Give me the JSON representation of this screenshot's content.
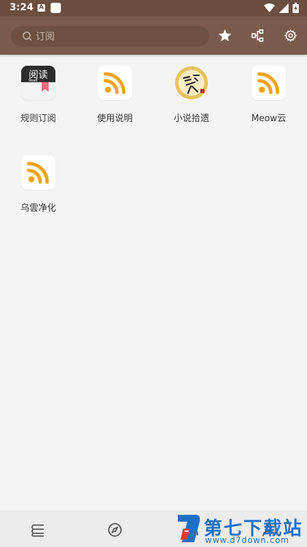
{
  "status_bar": {
    "time": "3:24",
    "a_badge": "A"
  },
  "toolbar": {
    "search_placeholder": "订阅"
  },
  "tiles": [
    {
      "label": "规则订阅",
      "icon": "read-app-icon",
      "icon_text": "阅读",
      "icon_subtext": "Read"
    },
    {
      "label": "使用说明",
      "icon": "rss-icon"
    },
    {
      "label": "小说拾遗",
      "icon": "book-seal-icon"
    },
    {
      "label": "Meow云",
      "icon": "rss-icon"
    },
    {
      "label": "乌雲净化",
      "icon": "rss-icon"
    }
  ],
  "watermark": {
    "title": "第七下载站",
    "url": "www.d7down.com"
  },
  "colors": {
    "toolbar": "#7a5b4b",
    "status": "#6b4e3f",
    "rss": "#f2a21b",
    "background": "#f4f4f4"
  }
}
